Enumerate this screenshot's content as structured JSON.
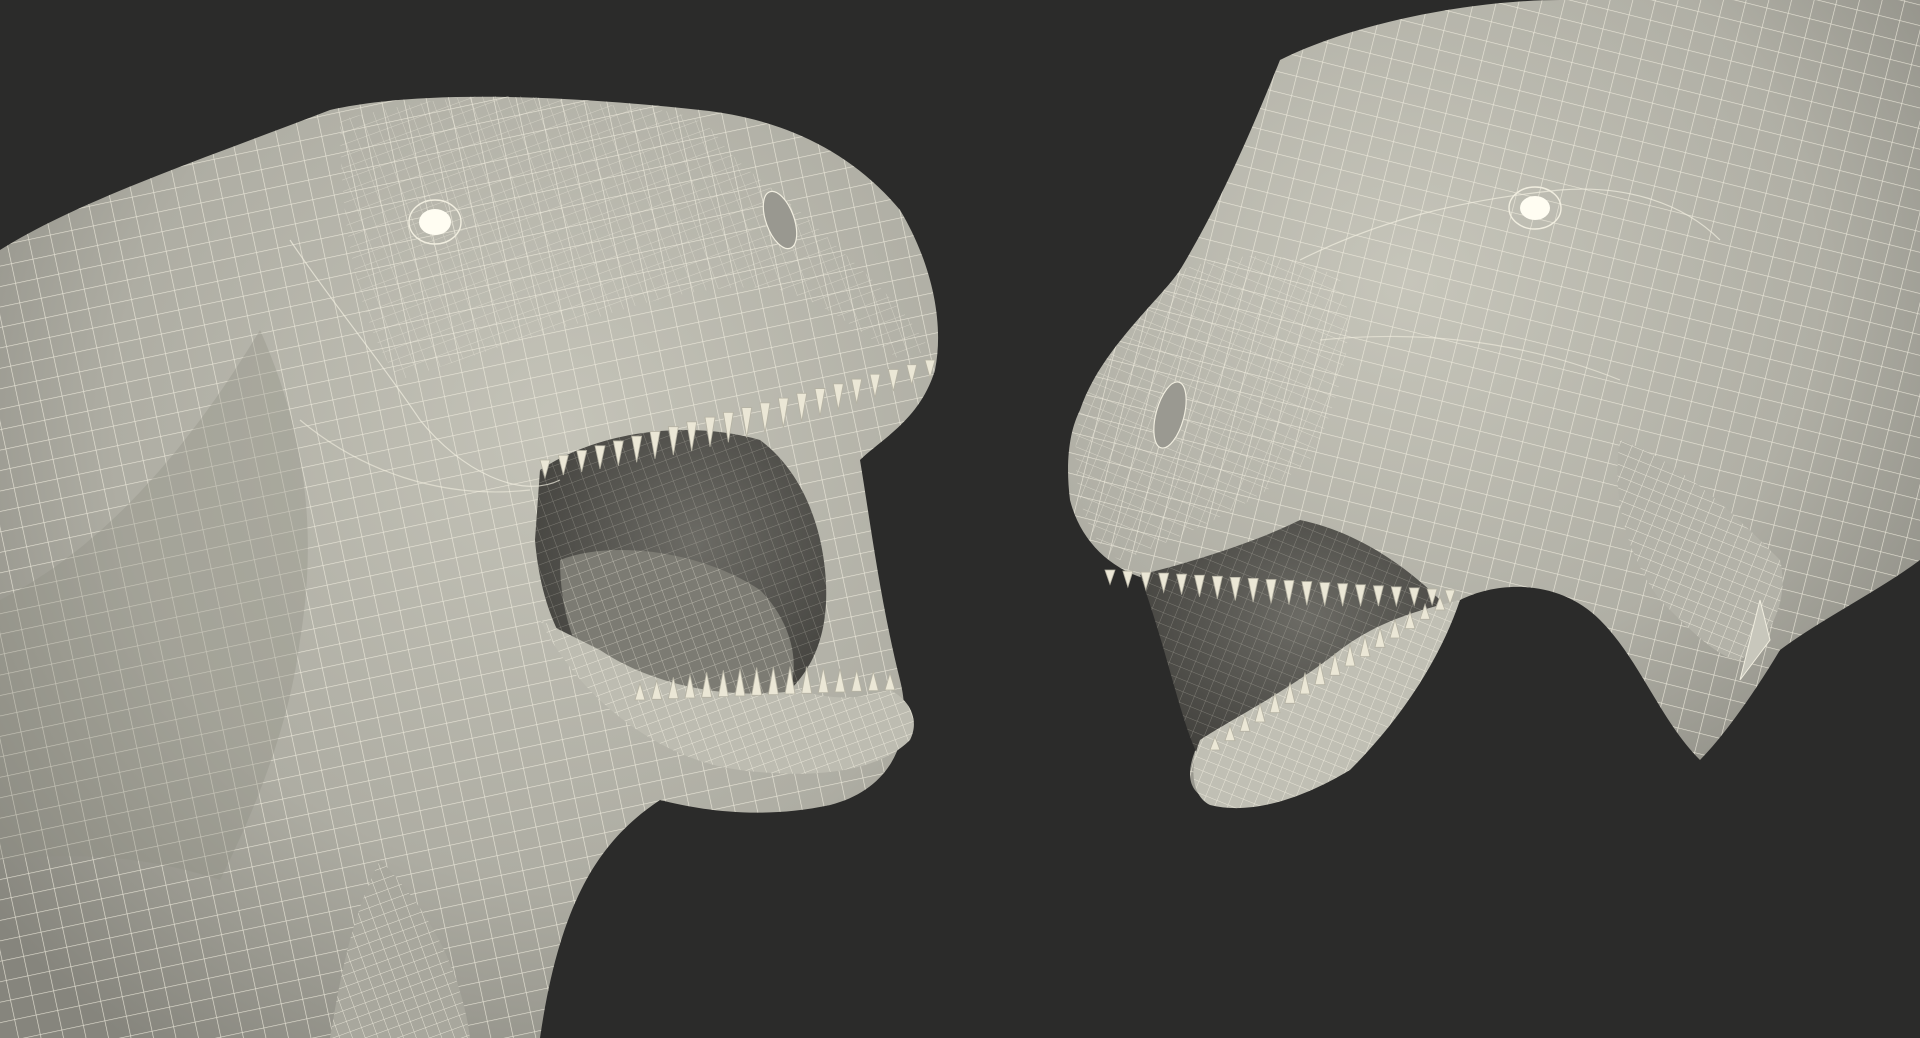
{
  "scene": {
    "subjects": [
      {
        "id": "left-trex",
        "label": "",
        "facing": "right",
        "mouth": "open"
      },
      {
        "id": "right-trex",
        "label": "",
        "facing": "left",
        "mouth": "open"
      }
    ]
  },
  "colors": {
    "background": "#2b2b2a",
    "skin": "#b9b8ad",
    "skin_shadow": "#8f8e85",
    "wire": "#f1eee0",
    "mouth_dark": "#55544f",
    "teeth": "#ebe7d6",
    "eye": "#fffdf2"
  }
}
